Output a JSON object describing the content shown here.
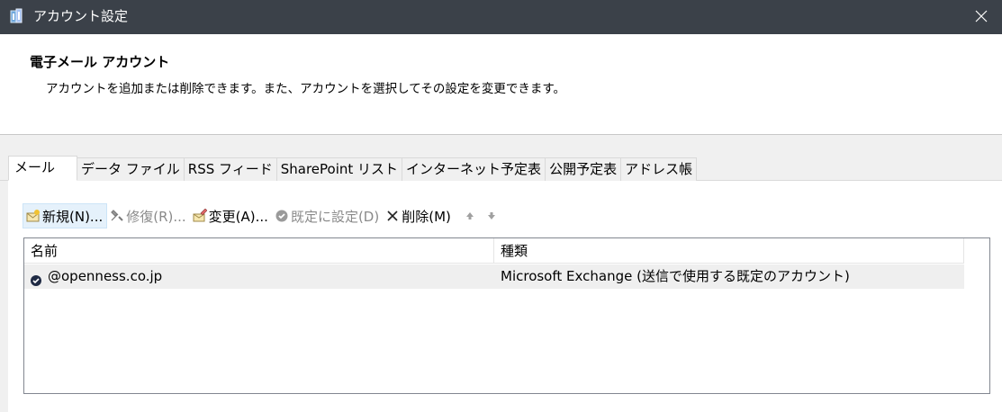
{
  "window": {
    "title": "アカウント設定",
    "icons": {
      "app": "account-settings-icon",
      "close": "close-icon"
    }
  },
  "header": {
    "heading": "電子メール アカウント",
    "description": "アカウントを追加または削除できます。また、アカウントを選択してその設定を変更できます。"
  },
  "tabs": [
    {
      "label": "メール",
      "active": true
    },
    {
      "label": "データ ファイル",
      "active": false
    },
    {
      "label": "RSS フィード",
      "active": false
    },
    {
      "label": "SharePoint リスト",
      "active": false
    },
    {
      "label": "インターネット予定表",
      "active": false
    },
    {
      "label": "公開予定表",
      "active": false
    },
    {
      "label": "アドレス帳",
      "active": false
    }
  ],
  "toolbar": {
    "new_label": "新規(N)...",
    "repair_label": "修復(R)...",
    "change_label": "変更(A)...",
    "set_default_label": "既定に設定(D)",
    "remove_label": "削除(M)",
    "icons": [
      "new-account-icon",
      "repair-icon",
      "change-icon",
      "set-default-icon",
      "remove-icon",
      "move-up-icon",
      "move-down-icon"
    ]
  },
  "accounts_list": {
    "columns": [
      "名前",
      "種類"
    ],
    "rows": [
      {
        "name": "@openness.co.jp",
        "type": "Microsoft Exchange (送信で使用する既定のアカウント)",
        "icon": "default-account-check-icon"
      }
    ]
  },
  "colors": {
    "titlebar": "#3b4149",
    "panel": "#f0f0f0",
    "selected_row": "#efefef",
    "hot_button": "#e5f1fb",
    "disabled_text": "#8a8a8a"
  }
}
